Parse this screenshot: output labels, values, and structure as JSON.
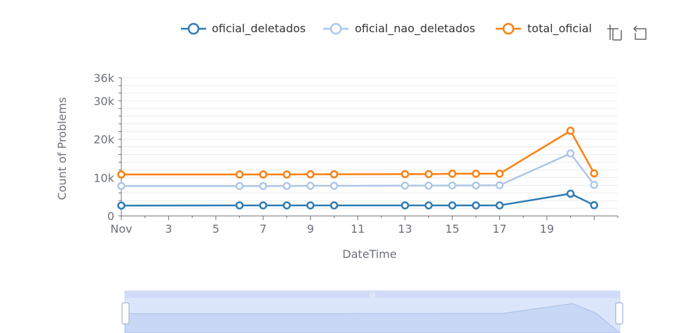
{
  "colors": {
    "oficial_deletados": "#2e7bb4",
    "oficial_nao_deletados": "#aec7e8",
    "total_oficial": "#ff7f0e",
    "grid": "#e9ecf2",
    "axis": "#6e7079",
    "zoom_fill": "#dce6fb",
    "zoom_border": "#c9d6f2"
  },
  "toolbox": {
    "zoom_icon": "data-zoom-icon",
    "restore_icon": "data-zoom-restore-icon"
  },
  "chart_data": {
    "type": "line",
    "xlabel": "DateTime",
    "ylabel": "Count of Problems",
    "xlim": [
      1,
      22
    ],
    "ylim": [
      0,
      36000
    ],
    "x_ticks": [
      {
        "value": 1,
        "label": "Nov"
      },
      {
        "value": 3,
        "label": "3"
      },
      {
        "value": 5,
        "label": "5"
      },
      {
        "value": 7,
        "label": "7"
      },
      {
        "value": 9,
        "label": "9"
      },
      {
        "value": 11,
        "label": "11"
      },
      {
        "value": 13,
        "label": "13"
      },
      {
        "value": 15,
        "label": "15"
      },
      {
        "value": 17,
        "label": "17"
      },
      {
        "value": 19,
        "label": "19"
      }
    ],
    "y_ticks": [
      {
        "value": 0,
        "label": "0"
      },
      {
        "value": 10000,
        "label": "10k"
      },
      {
        "value": 20000,
        "label": "20k"
      },
      {
        "value": 30000,
        "label": "30k"
      },
      {
        "value": 36000,
        "label": "36k"
      }
    ],
    "grid": true,
    "legend_position": "top-right",
    "x": [
      1,
      6,
      7,
      8,
      9,
      10,
      13,
      14,
      15,
      16,
      17,
      20,
      21
    ],
    "series": [
      {
        "name": "oficial_deletados",
        "color_key": "oficial_deletados",
        "values": [
          2700,
          2750,
          2750,
          2750,
          2750,
          2750,
          2750,
          2750,
          2750,
          2750,
          2750,
          5800,
          2800
        ]
      },
      {
        "name": "oficial_nao_deletados",
        "color_key": "oficial_nao_deletados",
        "values": [
          7800,
          7800,
          7800,
          7800,
          7850,
          7850,
          7900,
          7900,
          7950,
          7950,
          8000,
          16300,
          8100
        ]
      },
      {
        "name": "total_oficial",
        "color_key": "total_oficial",
        "values": [
          10800,
          10800,
          10800,
          10800,
          10850,
          10850,
          10900,
          10900,
          11000,
          11000,
          11000,
          22200,
          11100
        ]
      }
    ],
    "data_zoom": {
      "start_percent": 0,
      "end_percent": 100
    }
  }
}
